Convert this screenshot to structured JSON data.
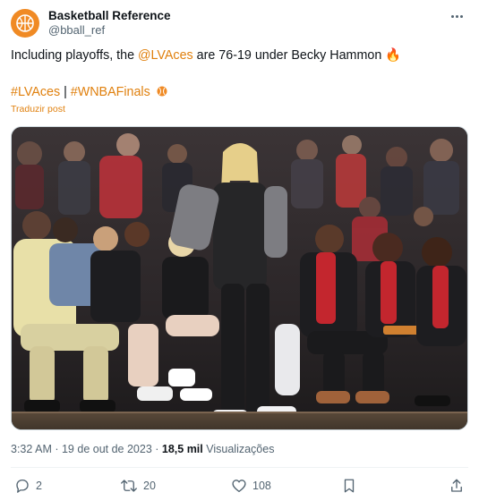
{
  "post": {
    "author_name": "Basketball Reference",
    "author_handle": "@bball_ref",
    "text_prefix": "Including playoffs, the ",
    "mention": "@LVAces",
    "text_suffix": " are 76-19 under Becky Hammon",
    "emoji_fire": "🔥",
    "hashtag_1": "#LVAces",
    "separator": " | ",
    "hashtag_2": "#WNBAFinals",
    "translate_label": "Traduzir post",
    "time": "3:32 AM",
    "dot": " · ",
    "date": "19 de out de 2023",
    "views_count": "18,5 mil",
    "views_label": "Visualizações"
  },
  "actions": {
    "replies": "2",
    "reposts": "20",
    "likes": "108"
  },
  "colors": {
    "accent": "#e0800e",
    "avatar_bg": "#f08a24",
    "muted": "#536471"
  },
  "icons": {
    "avatar": "basketball-logo",
    "more": "more-dots-icon",
    "reply": "reply-icon",
    "repost": "repost-icon",
    "like": "heart-icon",
    "bookmark": "bookmark-icon",
    "share": "share-icon"
  }
}
